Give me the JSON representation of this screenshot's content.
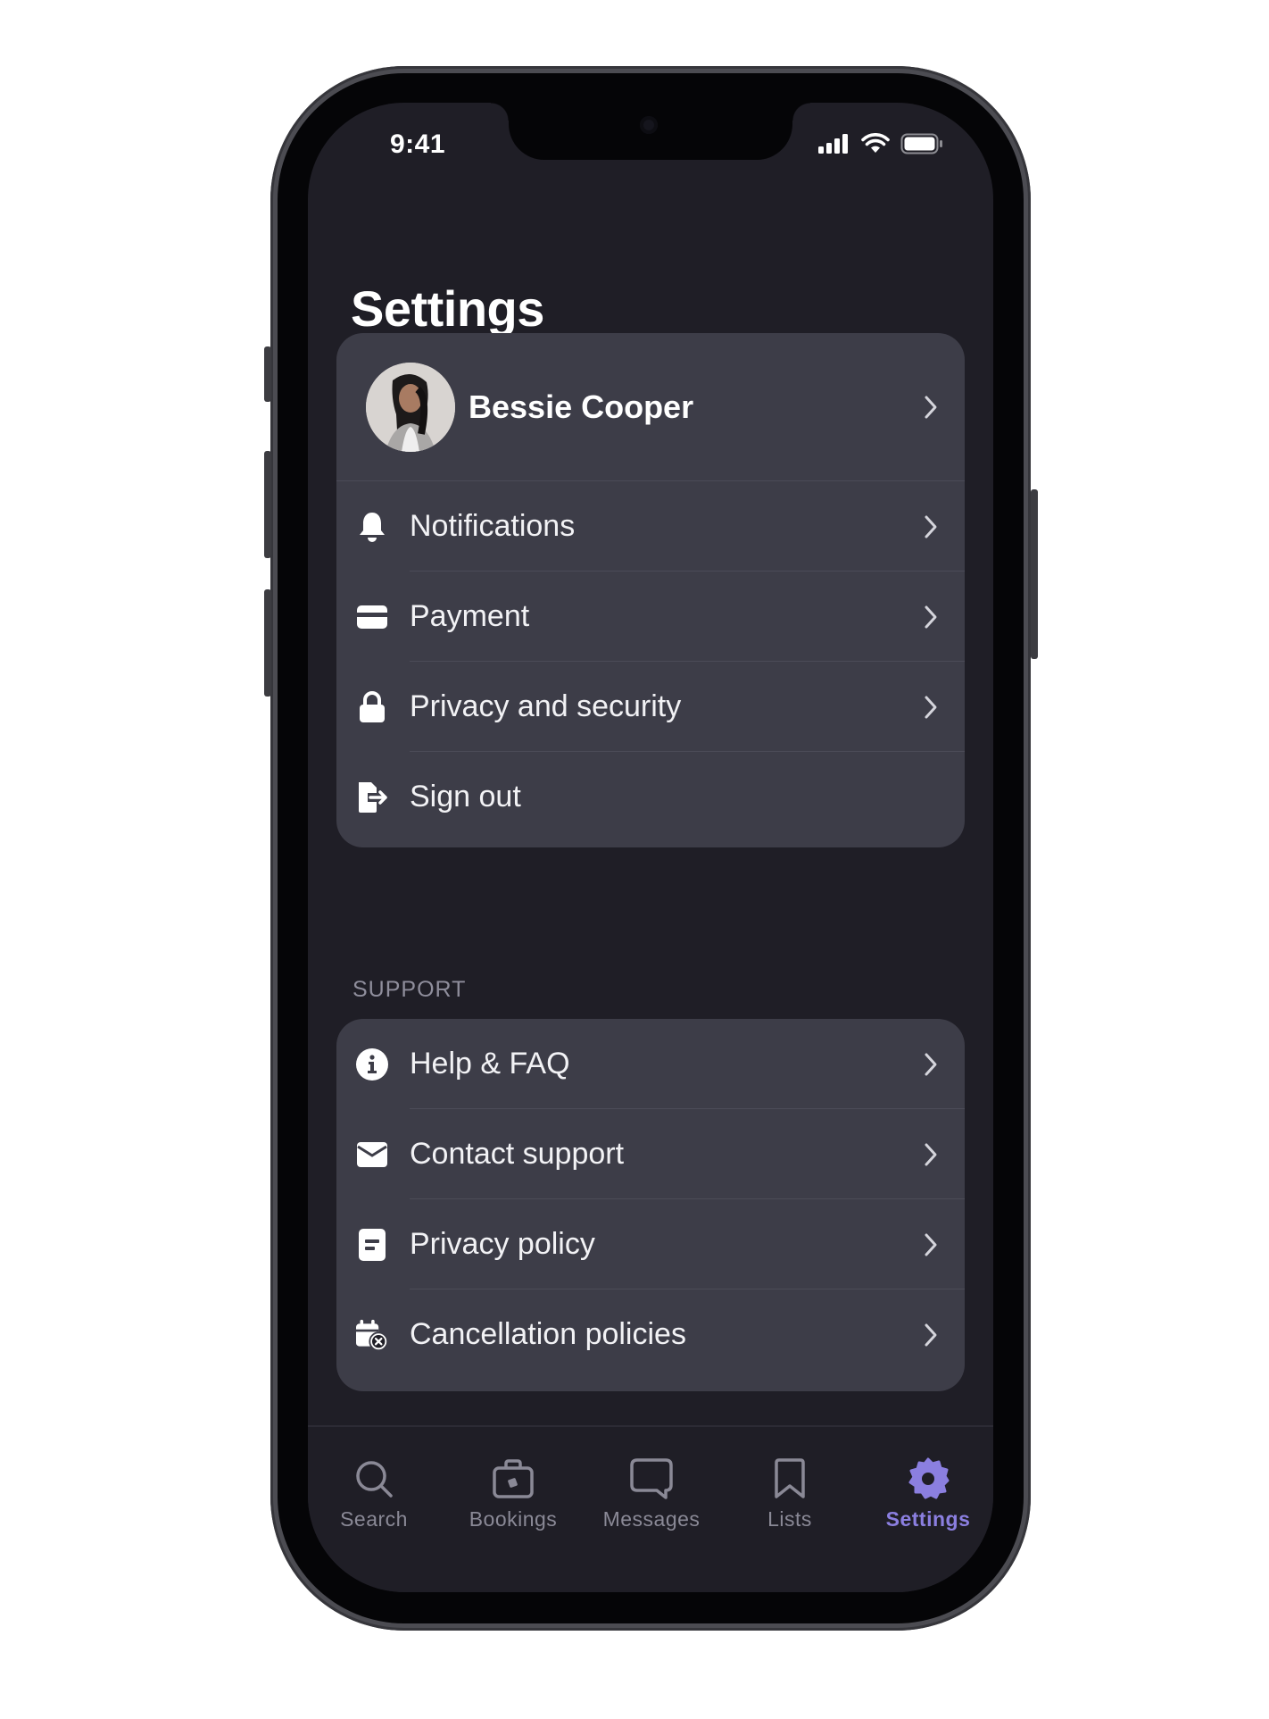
{
  "status_bar": {
    "time": "9:41"
  },
  "page": {
    "title": "Settings"
  },
  "profile": {
    "name": "Bessie Cooper"
  },
  "account_menu": [
    {
      "label": "Notifications",
      "icon": "bell-icon"
    },
    {
      "label": "Payment",
      "icon": "credit-card-icon"
    },
    {
      "label": "Privacy and security",
      "icon": "lock-icon"
    },
    {
      "label": "Sign out",
      "icon": "sign-out-icon"
    }
  ],
  "support": {
    "heading": "SUPPORT",
    "items": [
      {
        "label": "Help & FAQ",
        "icon": "info-icon"
      },
      {
        "label": "Contact support",
        "icon": "envelope-icon"
      },
      {
        "label": "Privacy policy",
        "icon": "document-icon"
      },
      {
        "label": "Cancellation policies",
        "icon": "calendar-cancel-icon"
      }
    ]
  },
  "tabbar": {
    "tabs": [
      {
        "label": "Search",
        "icon": "search-icon"
      },
      {
        "label": "Bookings",
        "icon": "briefcase-icon"
      },
      {
        "label": "Messages",
        "icon": "chat-bubble-icon"
      },
      {
        "label": "Lists",
        "icon": "bookmark-icon"
      },
      {
        "label": "Settings",
        "icon": "gear-icon"
      }
    ],
    "active": "Settings"
  },
  "colors": {
    "background": "#1f1e26",
    "card": "#3d3d48",
    "accent": "#8b7fe0",
    "muted_text": "#8a8996"
  }
}
